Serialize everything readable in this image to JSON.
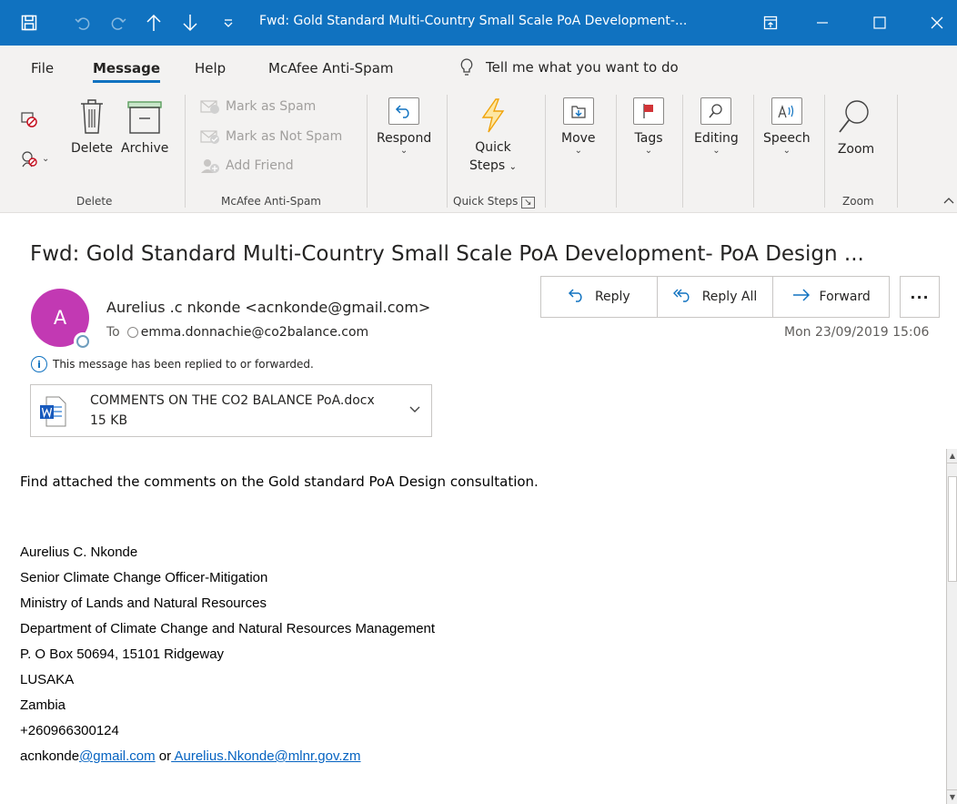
{
  "window": {
    "title": "Fwd: Gold Standard Multi-Country Small Scale PoA Development-...",
    "qat_icons": [
      "save-icon",
      "undo-icon",
      "redo-icon",
      "up-arrow-icon",
      "down-arrow-icon",
      "customize-icon"
    ],
    "controls": [
      "restore-ribbon-icon",
      "minimize-icon",
      "maximize-icon",
      "close-icon"
    ]
  },
  "menu": {
    "tabs": [
      "File",
      "Message",
      "Help",
      "McAfee Anti-Spam"
    ],
    "active_tab": "Message",
    "tell_me": "Tell me what you want to do"
  },
  "ribbon": {
    "delete_group": {
      "label": "Delete",
      "delete": "Delete",
      "archive": "Archive"
    },
    "spam_group": {
      "label": "McAfee Anti-Spam",
      "mark_spam": "Mark as Spam",
      "mark_not_spam": "Mark as Not Spam",
      "add_friend": "Add Friend"
    },
    "respond": "Respond",
    "quick_steps": {
      "label_line1": "Quick",
      "label_line2": "Steps",
      "group": "Quick Steps"
    },
    "move": "Move",
    "tags": "Tags",
    "editing": "Editing",
    "speech": "Speech",
    "zoom": {
      "label": "Zoom",
      "group": "Zoom"
    }
  },
  "email": {
    "subject": "Fwd: Gold Standard Multi-Country Small Scale PoA Development- PoA Design ...",
    "avatar_initial": "A",
    "sender": "Aurelius .c nkonde <acnkonde@gmail.com>",
    "to_label": "To",
    "to_address": "emma.donnachie@co2balance.com",
    "date": "Mon 23/09/2019 15:06",
    "actions": {
      "reply": "Reply",
      "reply_all": "Reply All",
      "forward": "Forward",
      "more": "···"
    },
    "info": "This message has been replied to or forwarded.",
    "attachment": {
      "name": "COMMENTS ON THE CO2 BALANCE PoA.docx",
      "size": "15 KB"
    },
    "body": "Find attached the comments on the Gold standard PoA Design consultation.",
    "signature": [
      "Aurelius C. Nkonde",
      "Senior Climate Change Officer-Mitigation",
      "Ministry of Lands and Natural Resources",
      "Department of Climate Change and Natural Resources Management",
      "P. O Box 50694, 15101 Ridgeway",
      "LUSAKA",
      "Zambia",
      "+260966300124"
    ],
    "contact": {
      "prefix": "acnkonde",
      "link1": "@gmail.com",
      "middle": " or",
      "link2": " Aurelius.Nkonde@mlnr.gov.zm"
    }
  },
  "colors": {
    "accent": "#1072c0",
    "avatar": "#c239b3",
    "link": "#0563c1",
    "ribbon_bg": "#f3f2f1"
  }
}
